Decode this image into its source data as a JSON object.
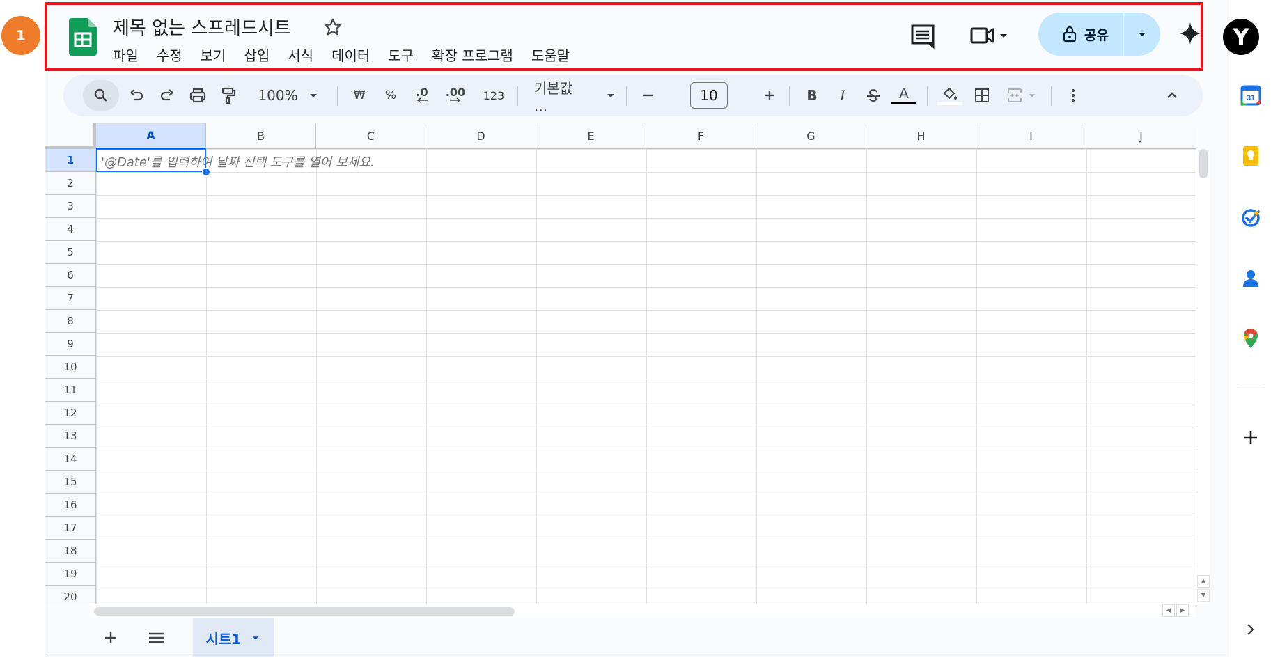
{
  "annotation": {
    "badge": "1"
  },
  "header": {
    "title": "제목 없는 스프레드시트",
    "menus": [
      "파일",
      "수정",
      "보기",
      "삽입",
      "서식",
      "데이터",
      "도구",
      "확장 프로그램",
      "도움말"
    ],
    "share_label": "공유"
  },
  "toolbar": {
    "zoom": "100%",
    "currency": "₩",
    "percent": "%",
    "decrease_decimal": ".0",
    "increase_decimal": ".00",
    "number_format": "123",
    "font": "기본값 ...",
    "font_size": "10",
    "bold": "B",
    "italic": "I",
    "text_color_letter": "A"
  },
  "grid": {
    "columns": [
      "A",
      "B",
      "C",
      "D",
      "E",
      "F",
      "G",
      "H",
      "I",
      "J"
    ],
    "rows": [
      "1",
      "2",
      "3",
      "4",
      "5",
      "6",
      "7",
      "8",
      "9",
      "10",
      "11",
      "12",
      "13",
      "14",
      "15",
      "16",
      "17",
      "18",
      "19",
      "20"
    ],
    "selected_column": "A",
    "selected_row": "1",
    "cell_hint": "'@Date'를 입력하여 날짜 선택 도구를 열어 보세요."
  },
  "sheets": {
    "active_tab": "시트1"
  },
  "account": {
    "avatar_letter": "Y"
  },
  "colors": {
    "accent": "#0b57d0",
    "share_bg": "#c2e7ff",
    "annotation": "#e8161b",
    "badge": "#ee7c2b"
  }
}
